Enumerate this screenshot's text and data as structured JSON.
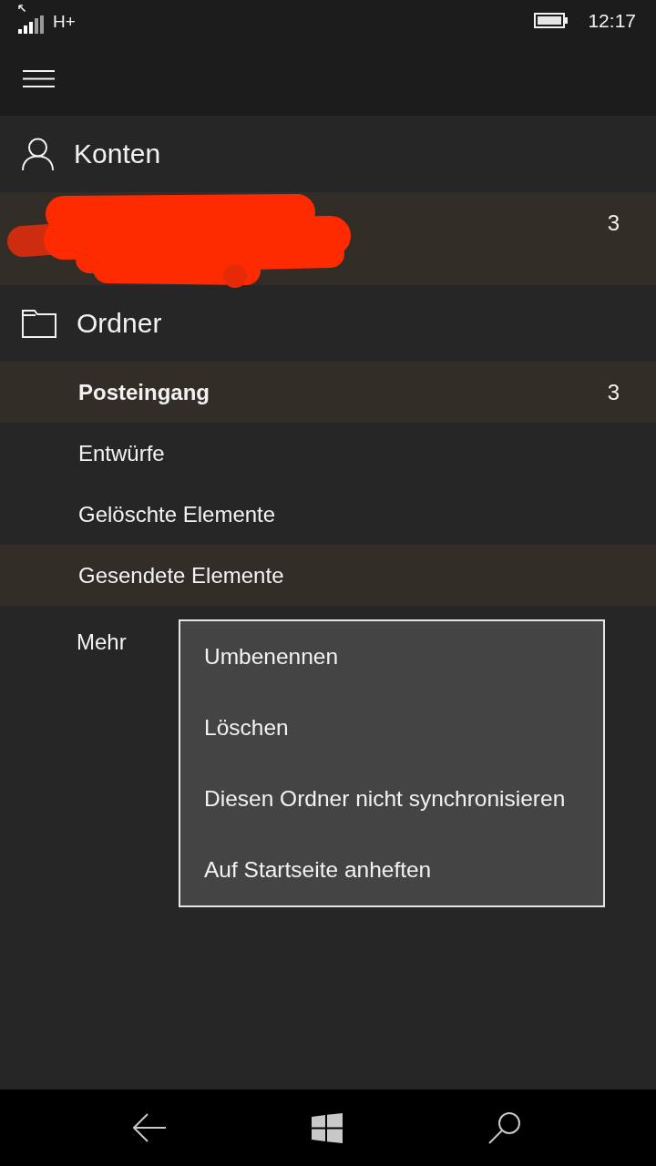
{
  "status_bar": {
    "network": "H+",
    "time": "12:17"
  },
  "accounts": {
    "title": "Konten",
    "items": [
      {
        "redacted": true,
        "count": "3",
        "selected": true
      }
    ]
  },
  "folders": {
    "title": "Ordner",
    "items": [
      {
        "label": "Posteingang",
        "count": "3",
        "unread": true,
        "selected": true
      },
      {
        "label": "Entwürfe",
        "unread": false,
        "selected": false
      },
      {
        "label": "Gelöschte Elemente",
        "unread": false,
        "selected": false
      },
      {
        "label": "Gesendete Elemente",
        "unread": false,
        "selected": true
      }
    ],
    "more": "Mehr"
  },
  "context_menu": {
    "items": [
      "Umbenennen",
      "Löschen",
      "Diesen Ordner nicht synchronisieren",
      "Auf Startseite anheften"
    ]
  }
}
